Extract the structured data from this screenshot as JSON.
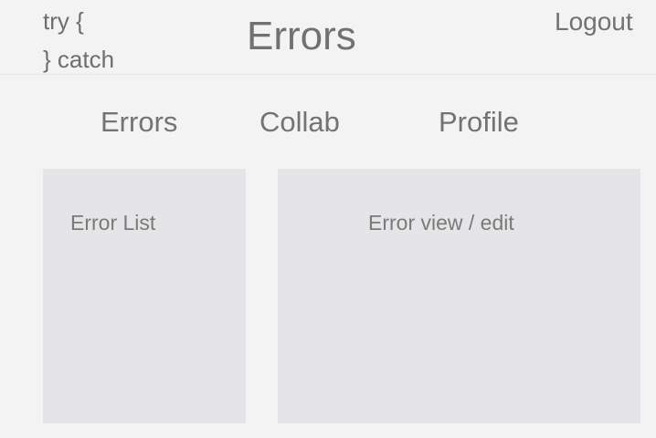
{
  "header": {
    "logo_line1": "try {",
    "logo_line2": "} catch",
    "title": "Errors",
    "logout_label": "Logout"
  },
  "nav": {
    "errors_label": "Errors",
    "collab_label": "Collab",
    "profile_label": "Profile"
  },
  "panels": {
    "list_label": "Error List",
    "view_label": "Error view / edit"
  }
}
